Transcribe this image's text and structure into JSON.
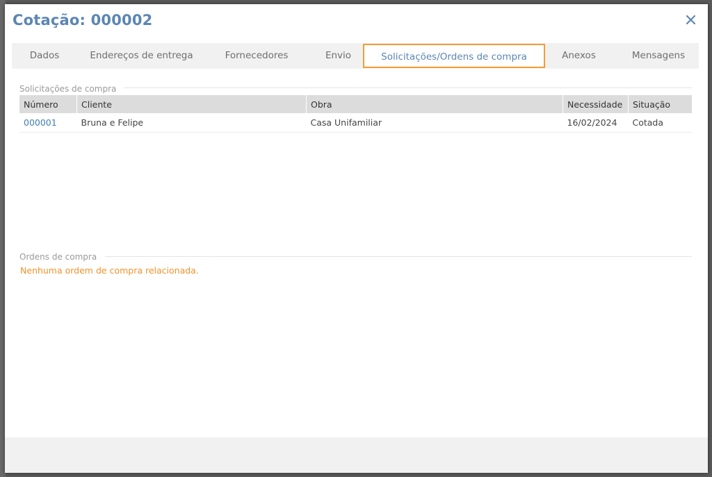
{
  "modal": {
    "title": "Cotação: 000002",
    "close_icon": "close-icon"
  },
  "tabs": [
    {
      "label": "Dados"
    },
    {
      "label": "Endereços de entrega"
    },
    {
      "label": "Fornecedores"
    },
    {
      "label": "Envio"
    },
    {
      "label": "Solicitações/Ordens de compra",
      "active": true
    },
    {
      "label": "Anexos"
    },
    {
      "label": "Mensagens"
    }
  ],
  "requests": {
    "section_title": "Solicitações de compra",
    "columns": [
      "Número",
      "Cliente",
      "Obra",
      "Necessidade",
      "Situação"
    ],
    "rows": [
      {
        "numero": "000001",
        "cliente": "Bruna e Felipe",
        "obra": "Casa Unifamiliar",
        "necessidade": "16/02/2024",
        "situacao": "Cotada"
      }
    ]
  },
  "orders": {
    "section_title": "Ordens de compra",
    "empty_message": "Nenhuma ordem de compra relacionada."
  },
  "colors": {
    "accent": "#5b86b3",
    "active_tab_border": "#f39c33",
    "empty_text": "#f0922a",
    "link": "#3f7fb4"
  }
}
